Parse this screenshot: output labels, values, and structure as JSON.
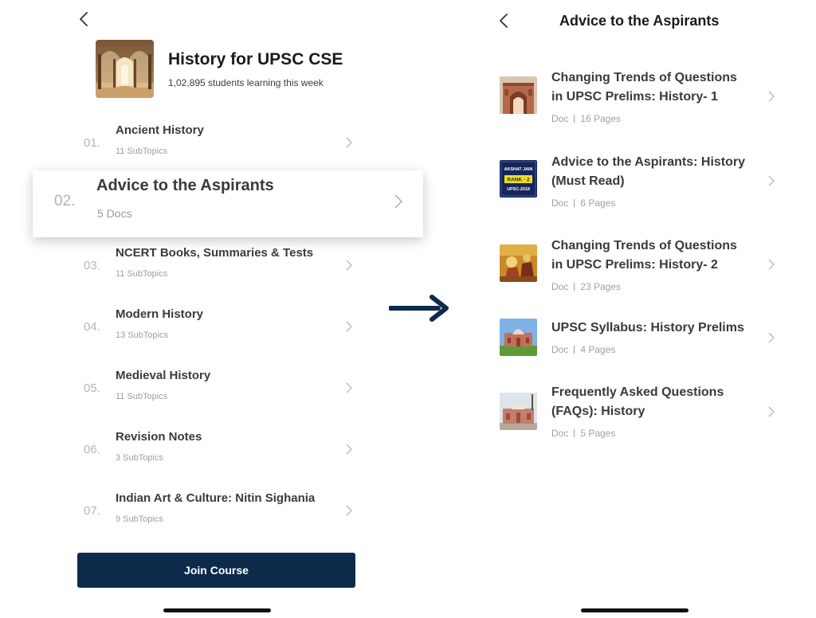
{
  "left_screen": {
    "course": {
      "title": "History for UPSC CSE",
      "subtitle": "1,02,895 students learning this week"
    },
    "topics": [
      {
        "num": "01.",
        "title": "Ancient History",
        "sub": "11 SubTopics"
      },
      {
        "num": "02.",
        "title": "Advice to the Aspirants",
        "sub": "5 Docs",
        "highlighted": true
      },
      {
        "num": "03.",
        "title": "NCERT Books, Summaries & Tests",
        "sub": "11 SubTopics"
      },
      {
        "num": "04.",
        "title": "Modern History",
        "sub": "13 SubTopics"
      },
      {
        "num": "05.",
        "title": "Medieval History",
        "sub": "11 SubTopics"
      },
      {
        "num": "06.",
        "title": "Revision Notes",
        "sub": "3 SubTopics"
      },
      {
        "num": "07.",
        "title": "Indian Art & Culture: Nitin Sighania",
        "sub": "9 SubTopics"
      }
    ],
    "join_button": "Join Course"
  },
  "right_screen": {
    "title": "Advice to the Aspirants",
    "docs": [
      {
        "title": "Changing Trends of Questions in UPSC Prelims: History- 1",
        "type": "Doc",
        "pages": "16 Pages",
        "thumb": "fort-gate-thumbnail"
      },
      {
        "title": "Advice to the Aspirants: History (Must Read)",
        "type": "Doc",
        "pages": "6 Pages",
        "thumb": "rank-badge-thumbnail",
        "thumb_text": [
          "AKSHAT JAIN",
          "RANK - 2",
          "UPSC-2018"
        ]
      },
      {
        "title": "Changing Trends of Questions in UPSC Prelims: History- 2",
        "type": "Doc",
        "pages": "23 Pages",
        "thumb": "painting-thumbnail"
      },
      {
        "title": "UPSC Syllabus: History Prelims",
        "type": "Doc",
        "pages": "4 Pages",
        "thumb": "monument-thumbnail"
      },
      {
        "title": "Frequently Asked Questions (FAQs): History",
        "type": "Doc",
        "pages": "5 Pages",
        "thumb": "tomb-thumbnail"
      }
    ]
  },
  "colors": {
    "primary_button": "#0d2a4b",
    "arrow": "#0d2a4b",
    "muted_text": "#9e9e9e"
  },
  "icons": [
    "back-chevron-icon",
    "chevron-right-icon",
    "arrow-right-icon"
  ]
}
